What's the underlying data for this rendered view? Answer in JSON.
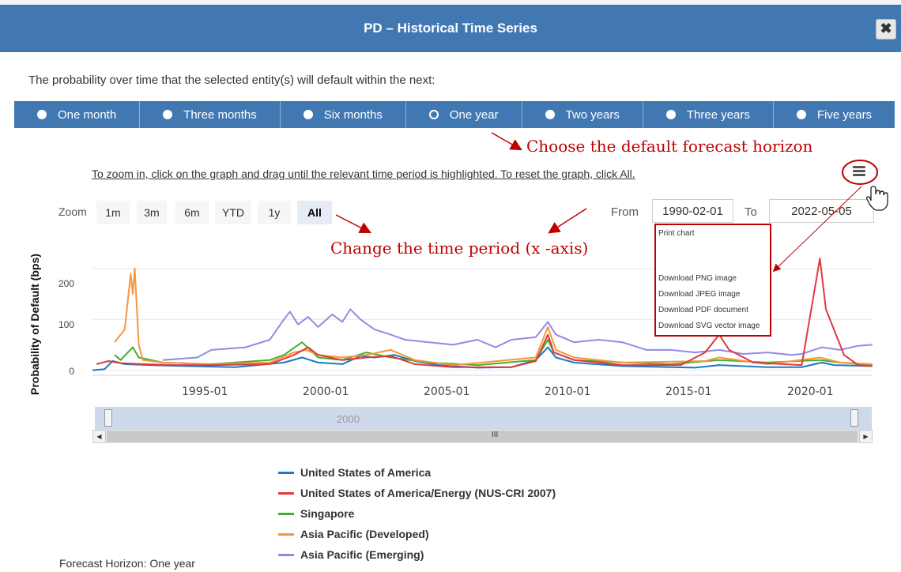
{
  "dialog": {
    "title": "PD – Historical Time Series",
    "close_label": "✖"
  },
  "intro_text": "The probability over time that the selected entity(s) will default within the next:",
  "horizons": [
    {
      "label": "One month",
      "selected": false
    },
    {
      "label": "Three months",
      "selected": false
    },
    {
      "label": "Six months",
      "selected": false
    },
    {
      "label": "One year",
      "selected": true
    },
    {
      "label": "Two years",
      "selected": false
    },
    {
      "label": "Three years",
      "selected": false
    },
    {
      "label": "Five years",
      "selected": false
    }
  ],
  "annotations": {
    "forecast": "Choose the default forecast horizon",
    "time_period": "Change the time period (x -axis)"
  },
  "zoom_instructions": "To zoom in, click on the graph and drag until the relevant time period is highlighted. To reset the graph, click All.",
  "zoom": {
    "label": "Zoom",
    "buttons": [
      "1m",
      "3m",
      "6m",
      "YTD",
      "1y",
      "All"
    ],
    "active": "All"
  },
  "range": {
    "from_label": "From",
    "from_value": "1990-02-01",
    "to_label": "To",
    "to_value": "2022-05-05"
  },
  "export_menu": [
    "Print chart",
    "Download PNG image",
    "Download JPEG image",
    "Download PDF document",
    "Download SVG vector image"
  ],
  "navigator": {
    "label": "2000",
    "grip": "III",
    "left_arrow": "◀",
    "right_arrow": "▶"
  },
  "chart_data": {
    "type": "line",
    "ylabel": "Probability of Default (bps)",
    "xlabel": "",
    "x_tick_labels": [
      "1995-01",
      "2000-01",
      "2005-01",
      "2010-01",
      "2015-01",
      "2020-01"
    ],
    "y_tick_labels": [
      "0",
      "100",
      "200"
    ],
    "xlim": [
      "1990-02-01",
      "2022-05-05"
    ],
    "ylim": [
      -10,
      270
    ],
    "legend_position": "bottom",
    "series": [
      {
        "name": "United States of America",
        "color": "#1f78c1",
        "points": [
          [
            "1990-02",
            0
          ],
          [
            "1990-08",
            2
          ],
          [
            "1990-12",
            18
          ],
          [
            "1991-06",
            12
          ],
          [
            "1992-06",
            10
          ],
          [
            "1994-01",
            8
          ],
          [
            "1996-01",
            6
          ],
          [
            "1998-01",
            15
          ],
          [
            "1998-10",
            25
          ],
          [
            "1999-06",
            15
          ],
          [
            "2000-06",
            12
          ],
          [
            "2001-03",
            28
          ],
          [
            "2001-10",
            25
          ],
          [
            "2002-08",
            30
          ],
          [
            "2003-06",
            18
          ],
          [
            "2004-06",
            10
          ],
          [
            "2006-01",
            5
          ],
          [
            "2007-06",
            6
          ],
          [
            "2008-06",
            20
          ],
          [
            "2008-12",
            45
          ],
          [
            "2009-04",
            25
          ],
          [
            "2010-01",
            15
          ],
          [
            "2012-01",
            8
          ],
          [
            "2015-01",
            5
          ],
          [
            "2016-01",
            10
          ],
          [
            "2018-01",
            6
          ],
          [
            "2019-06",
            6
          ],
          [
            "2020-04",
            15
          ],
          [
            "2020-10",
            10
          ],
          [
            "2022-05",
            8
          ]
        ]
      },
      {
        "name": "United States of America/Energy (NUS-CRI 2007)",
        "color": "#e0393e",
        "points": [
          [
            "1990-04",
            12
          ],
          [
            "1990-10",
            18
          ],
          [
            "1991-04",
            14
          ],
          [
            "1992-03",
            12
          ],
          [
            "1993-06",
            10
          ],
          [
            "1995-01",
            10
          ],
          [
            "1997-06",
            12
          ],
          [
            "1998-06",
            30
          ],
          [
            "1999-01",
            45
          ],
          [
            "1999-06",
            30
          ],
          [
            "2000-06",
            20
          ],
          [
            "2001-06",
            25
          ],
          [
            "2002-06",
            28
          ],
          [
            "2003-06",
            12
          ],
          [
            "2005-01",
            6
          ],
          [
            "2007-06",
            6
          ],
          [
            "2008-06",
            18
          ],
          [
            "2008-12",
            70
          ],
          [
            "2009-03",
            35
          ],
          [
            "2010-01",
            20
          ],
          [
            "2012-01",
            10
          ],
          [
            "2014-06",
            10
          ],
          [
            "2015-06",
            35
          ],
          [
            "2016-01",
            70
          ],
          [
            "2016-06",
            40
          ],
          [
            "2017-06",
            15
          ],
          [
            "2019-06",
            10
          ],
          [
            "2020-03",
            220
          ],
          [
            "2020-06",
            120
          ],
          [
            "2020-10",
            80
          ],
          [
            "2021-03",
            30
          ],
          [
            "2021-10",
            10
          ],
          [
            "2022-05",
            8
          ]
        ]
      },
      {
        "name": "Singapore",
        "color": "#43b02a",
        "points": [
          [
            "1991-01",
            30
          ],
          [
            "1991-04",
            20
          ],
          [
            "1991-10",
            45
          ],
          [
            "1992-01",
            25
          ],
          [
            "1993-01",
            15
          ],
          [
            "1995-01",
            12
          ],
          [
            "1997-06",
            20
          ],
          [
            "1998-01",
            30
          ],
          [
            "1998-10",
            55
          ],
          [
            "1999-06",
            25
          ],
          [
            "2000-06",
            20
          ],
          [
            "2001-06",
            35
          ],
          [
            "2002-06",
            25
          ],
          [
            "2004-01",
            15
          ],
          [
            "2006-01",
            10
          ],
          [
            "2008-06",
            20
          ],
          [
            "2008-12",
            60
          ],
          [
            "2009-03",
            35
          ],
          [
            "2010-01",
            20
          ],
          [
            "2012-01",
            15
          ],
          [
            "2014-01",
            12
          ],
          [
            "2016-01",
            20
          ],
          [
            "2018-01",
            15
          ],
          [
            "2020-03",
            20
          ],
          [
            "2021-01",
            15
          ],
          [
            "2022-05",
            10
          ]
        ]
      },
      {
        "name": "Asia Pacific (Developed)",
        "color": "#f7963d",
        "points": [
          [
            "1991-01",
            55
          ],
          [
            "1991-06",
            80
          ],
          [
            "1991-09",
            190
          ],
          [
            "1991-10",
            150
          ],
          [
            "1991-11",
            200
          ],
          [
            "1992-01",
            50
          ],
          [
            "1992-03",
            20
          ],
          [
            "1993-01",
            15
          ],
          [
            "1995-01",
            12
          ],
          [
            "1997-06",
            15
          ],
          [
            "1998-06",
            35
          ],
          [
            "1998-12",
            40
          ],
          [
            "1999-06",
            30
          ],
          [
            "2000-06",
            25
          ],
          [
            "2001-06",
            30
          ],
          [
            "2002-06",
            40
          ],
          [
            "2003-06",
            20
          ],
          [
            "2005-01",
            10
          ],
          [
            "2008-06",
            25
          ],
          [
            "2008-12",
            85
          ],
          [
            "2009-04",
            40
          ],
          [
            "2010-01",
            25
          ],
          [
            "2012-01",
            15
          ],
          [
            "2015-06",
            18
          ],
          [
            "2016-01",
            25
          ],
          [
            "2018-01",
            12
          ],
          [
            "2020-03",
            25
          ],
          [
            "2021-01",
            15
          ],
          [
            "2022-05",
            12
          ]
        ]
      },
      {
        "name": "Asia Pacific (Emerging)",
        "color": "#8f8ce4",
        "points": [
          [
            "1993-01",
            20
          ],
          [
            "1994-06",
            25
          ],
          [
            "1995-01",
            40
          ],
          [
            "1996-06",
            45
          ],
          [
            "1997-06",
            60
          ],
          [
            "1998-01",
            100
          ],
          [
            "1998-04",
            115
          ],
          [
            "1998-08",
            90
          ],
          [
            "1999-01",
            105
          ],
          [
            "1999-06",
            85
          ],
          [
            "2000-01",
            110
          ],
          [
            "2000-06",
            95
          ],
          [
            "2000-10",
            120
          ],
          [
            "2001-03",
            100
          ],
          [
            "2001-10",
            80
          ],
          [
            "2002-06",
            70
          ],
          [
            "2003-01",
            60
          ],
          [
            "2004-01",
            55
          ],
          [
            "2005-01",
            50
          ],
          [
            "2006-01",
            60
          ],
          [
            "2006-10",
            45
          ],
          [
            "2007-06",
            60
          ],
          [
            "2008-06",
            65
          ],
          [
            "2008-12",
            95
          ],
          [
            "2009-04",
            70
          ],
          [
            "2010-01",
            55
          ],
          [
            "2011-01",
            60
          ],
          [
            "2012-01",
            55
          ],
          [
            "2013-01",
            40
          ],
          [
            "2014-01",
            40
          ],
          [
            "2015-01",
            35
          ],
          [
            "2016-01",
            40
          ],
          [
            "2017-01",
            32
          ],
          [
            "2018-01",
            35
          ],
          [
            "2019-01",
            30
          ],
          [
            "2019-06",
            32
          ],
          [
            "2020-04",
            45
          ],
          [
            "2021-01",
            40
          ],
          [
            "2021-10",
            48
          ],
          [
            "2022-05",
            50
          ]
        ]
      }
    ]
  },
  "forecast_footer": "Forecast Horizon:  One year"
}
